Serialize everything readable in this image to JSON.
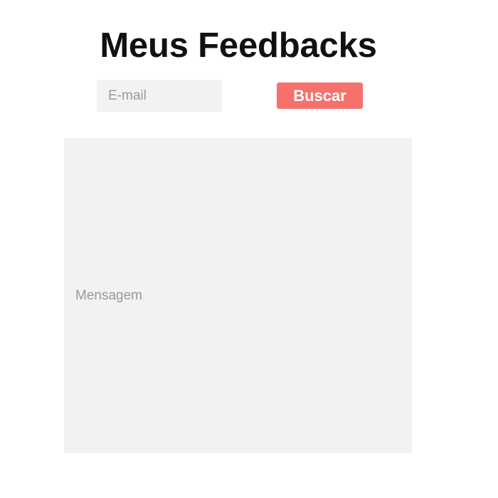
{
  "header": {
    "title": "Meus Feedbacks"
  },
  "search": {
    "email_placeholder": "E-mail",
    "email_value": "",
    "button_label": "Buscar"
  },
  "message": {
    "placeholder": "Mensagem",
    "value": ""
  },
  "colors": {
    "accent": "#f7716c",
    "field_background": "#f2f2f2",
    "title_text": "#111111",
    "placeholder_text": "#9a9a9a"
  }
}
